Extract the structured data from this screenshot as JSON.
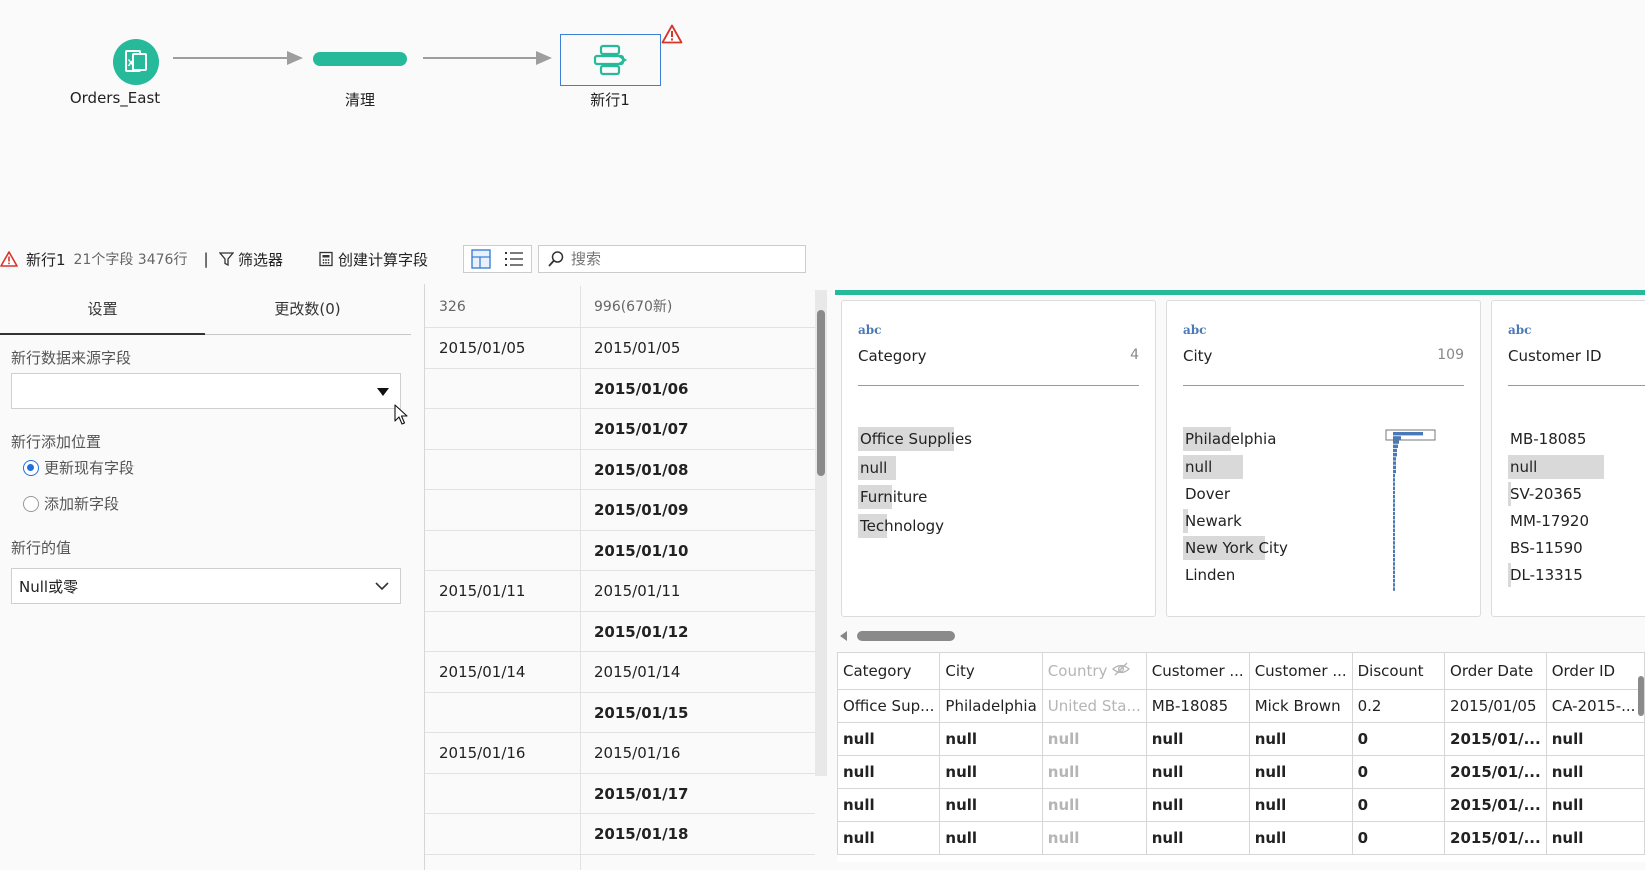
{
  "flow": {
    "nodes": [
      {
        "label": "Orders_East",
        "icon": "excel-file-icon"
      },
      {
        "label": "清理",
        "icon": "clean-step-icon"
      },
      {
        "label": "新行1",
        "icon": "new-rows-step-icon"
      }
    ],
    "colors": {
      "accent": "#26b99a",
      "selection": "#3d7fd6",
      "warning": "#d9342b"
    }
  },
  "toolbar": {
    "step_name": "新行1",
    "summary": "21个字段 3476行",
    "separator": "|",
    "filter_label": "筛选器",
    "calc_label": "创建计算字段",
    "search_placeholder": "搜索"
  },
  "left_panel": {
    "tabs": [
      "设置",
      "更改数(0)"
    ],
    "source_field_label": "新行数据来源字段",
    "source_field_value": "",
    "position_label": "新行添加位置",
    "position_options": [
      "更新现有字段",
      "添加新字段"
    ],
    "position_selected": 0,
    "value_label": "新行的值",
    "value_selected": "Null或零"
  },
  "middle": {
    "headers": [
      "326",
      "996(670新)"
    ],
    "rows": [
      [
        "2015/01/05",
        "2015/01/05",
        false
      ],
      [
        "",
        "2015/01/06",
        true
      ],
      [
        "",
        "2015/01/07",
        true
      ],
      [
        "",
        "2015/01/08",
        true
      ],
      [
        "",
        "2015/01/09",
        true
      ],
      [
        "",
        "2015/01/10",
        true
      ],
      [
        "2015/01/11",
        "2015/01/11",
        false
      ],
      [
        "",
        "2015/01/12",
        true
      ],
      [
        "2015/01/14",
        "2015/01/14",
        false
      ],
      [
        "",
        "2015/01/15",
        true
      ],
      [
        "2015/01/16",
        "2015/01/16",
        false
      ],
      [
        "",
        "2015/01/17",
        true
      ],
      [
        "",
        "2015/01/18",
        true
      ]
    ]
  },
  "profile_cards": [
    {
      "type": "abc",
      "name": "Category",
      "count": "4",
      "values": [
        {
          "v": "Office Supplies",
          "f": 1.0
        },
        {
          "v": "null",
          "f": 0.4
        },
        {
          "v": "Furniture",
          "f": 0.35
        },
        {
          "v": "Technology",
          "f": 0.3
        }
      ]
    },
    {
      "type": "abc",
      "name": "City",
      "count": "109",
      "values": [
        {
          "v": "Philadelphia",
          "f": 0.5
        },
        {
          "v": "null",
          "f": 0.63
        },
        {
          "v": "Dover",
          "f": 0.0
        },
        {
          "v": "Newark",
          "f": 0.05
        },
        {
          "v": "New York City",
          "f": 0.85
        },
        {
          "v": "Linden",
          "f": 0.0
        }
      ]
    },
    {
      "type": "abc",
      "name": "Customer ID",
      "count": "",
      "values": [
        {
          "v": "MB-18085",
          "f": 0.0
        },
        {
          "v": "null",
          "f": 1.0
        },
        {
          "v": "SV-20365",
          "f": 0.03
        },
        {
          "v": "MM-17920",
          "f": 0.0
        },
        {
          "v": "BS-11590",
          "f": 0.0
        },
        {
          "v": "DL-13315",
          "f": 0.03
        }
      ]
    }
  ],
  "grid": {
    "columns": [
      "Category",
      "City",
      "Country",
      "Customer ...",
      "Customer ...",
      "Discount",
      "Order Date",
      "Order ID"
    ],
    "hidden_columns": [
      "Country"
    ],
    "rows": [
      [
        "Office Sup...",
        "Philadelphia",
        "United Sta...",
        "MB-18085",
        "Mick Brown",
        "0.2",
        "2015/01/05",
        "CA-2015-..."
      ],
      [
        "null",
        "null",
        "null",
        "null",
        "null",
        "0",
        "2015/01/...",
        "null"
      ],
      [
        "null",
        "null",
        "null",
        "null",
        "null",
        "0",
        "2015/01/...",
        "null"
      ],
      [
        "null",
        "null",
        "null",
        "null",
        "null",
        "0",
        "2015/01/...",
        "null"
      ],
      [
        "null",
        "null",
        "null",
        "null",
        "null",
        "0",
        "2015/01/...",
        "null"
      ]
    ]
  }
}
